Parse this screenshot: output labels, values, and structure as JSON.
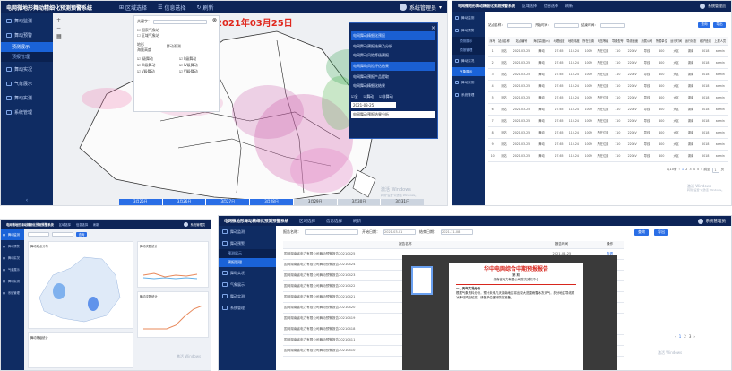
{
  "app_title": "电网微地形舞动精细化预测预警系统",
  "nav": [
    "区域选择",
    "信息选择",
    "刷新"
  ],
  "user": "系统管理员",
  "sidebar1": [
    "舞动监测",
    "舞动预警",
    "预测展示",
    "预报管理",
    "舞动实况",
    "气象展示",
    "舞动实测",
    "系统管理"
  ],
  "sidebar2": [
    "舞动监测",
    "舞动预警",
    "预测展示",
    "预报管理",
    "舞动实况",
    "气象展示",
    "舞动实测",
    "系统管理"
  ],
  "map": {
    "date": "2021年03月25日",
    "legend_search": "关键字：",
    "legend_checks": [
      "国家气象站",
      "区域气象站",
      "地形",
      "海拔高度"
    ],
    "legend_right": "舞动观测",
    "legend_levels": [
      "I级舞动",
      "II级舞动",
      "III级舞动",
      "IV级舞动",
      "V级舞动",
      "VI级舞动"
    ],
    "panel_items": [
      "电网舞动精细化预报",
      "电网舞动预报结果及分析",
      "电网舞动风险等级预报",
      "电网舞动风险评估结果",
      "电网舞动预报产品提取",
      "电网舞动精细化结果"
    ],
    "panel_checks": [
      "全",
      "舞动",
      "非舞动"
    ],
    "panel_date": "2021-03-25",
    "panel_select": "电网舞动预报结果分析",
    "timeline": [
      "3月25日",
      "3月26日",
      "3月27日",
      "3月28日",
      "3月29日",
      "3月30日",
      "3月31日"
    ],
    "activate": [
      "激活 Windows",
      "转到\"设置\"以激活 Windows。"
    ]
  },
  "table": {
    "filters": [
      "站点名称：",
      "开始时间：",
      "结束时间：",
      "站点名称：",
      "开始日期："
    ],
    "search": "查询",
    "export": "导出",
    "headers": [
      "序号",
      "站点名称",
      "站点编号",
      "海拔高度(m)",
      "地理经度",
      "地理纬度",
      "所在位置",
      "电压等级",
      "导线型号",
      "导线截面",
      "所属公司",
      "所属单位",
      "运行时间",
      "运行状态",
      "维护班组",
      "上报人员"
    ],
    "rows": [
      [
        "1",
        "测站",
        "2021-03-25",
        "舞动",
        "27.65",
        "110.24",
        "1009",
        "所在位置",
        "110",
        "220kV",
        "导线",
        "400",
        "大区",
        "湖南",
        "2018",
        "admin"
      ],
      [
        "2",
        "测站",
        "2021-03-25",
        "舞动",
        "27.65",
        "110.24",
        "1009",
        "所在位置",
        "110",
        "220kV",
        "导线",
        "400",
        "大区",
        "湖南",
        "2018",
        "admin"
      ],
      [
        "3",
        "测站",
        "2021-03-25",
        "舞动",
        "27.65",
        "110.24",
        "1009",
        "所在位置",
        "110",
        "220kV",
        "导线",
        "400",
        "大区",
        "湖南",
        "2018",
        "admin"
      ],
      [
        "4",
        "测站",
        "2021-03-25",
        "舞动",
        "27.65",
        "110.24",
        "1009",
        "所在位置",
        "110",
        "220kV",
        "导线",
        "400",
        "大区",
        "湖南",
        "2018",
        "admin"
      ],
      [
        "5",
        "测站",
        "2021-03-25",
        "舞动",
        "27.65",
        "110.24",
        "1009",
        "所在位置",
        "110",
        "220kV",
        "导线",
        "400",
        "大区",
        "湖南",
        "2018",
        "admin"
      ],
      [
        "6",
        "测站",
        "2021-03-25",
        "舞动",
        "27.65",
        "110.24",
        "1009",
        "所在位置",
        "110",
        "220kV",
        "导线",
        "400",
        "大区",
        "湖南",
        "2018",
        "admin"
      ],
      [
        "7",
        "测站",
        "2021-03-25",
        "舞动",
        "27.65",
        "110.24",
        "1009",
        "所在位置",
        "110",
        "220kV",
        "导线",
        "400",
        "大区",
        "湖南",
        "2018",
        "admin"
      ],
      [
        "8",
        "测站",
        "2021-03-25",
        "舞动",
        "27.65",
        "110.24",
        "1009",
        "所在位置",
        "110",
        "220kV",
        "导线",
        "400",
        "大区",
        "湖南",
        "2018",
        "admin"
      ],
      [
        "9",
        "测站",
        "2021-03-25",
        "舞动",
        "27.65",
        "110.24",
        "1009",
        "所在位置",
        "110",
        "220kV",
        "导线",
        "400",
        "大区",
        "湖南",
        "2018",
        "admin"
      ],
      [
        "10",
        "测站",
        "2021-03-25",
        "舞动",
        "27.65",
        "110.24",
        "1009",
        "所在位置",
        "110",
        "220kV",
        "导线",
        "400",
        "大区",
        "湖南",
        "2018",
        "admin"
      ]
    ],
    "pager": [
      "共10条",
      "1",
      "2",
      "3",
      "4",
      "5",
      "跳至",
      "1",
      "页"
    ],
    "activate": [
      "激活 Windows",
      "转到\"设置\"以激活 Windows。"
    ]
  },
  "dash": {
    "topnav": [
      "区域选择",
      "信息选择",
      "刷新"
    ],
    "sidebar": [
      "舞动监测",
      "舞动预警",
      "舞动实况",
      "气象展示",
      "舞动实测",
      "系统管理"
    ],
    "filter": "查询",
    "cards": [
      "舞动站点分布",
      "舞动次数统计",
      "舞动次数统计",
      "舞动等级统计"
    ],
    "activate": "激活 Windows"
  },
  "report": {
    "sidebar": [
      "舞动监测",
      "舞动预警",
      "预测展示",
      "预报管理",
      "舞动实况",
      "气象展示",
      "舞动实测",
      "系统管理"
    ],
    "filters": [
      "报告名称：",
      "开始日期：",
      "2021-03-01",
      "结束日期：",
      "2021-11-08"
    ],
    "search": "查询",
    "export": "导出",
    "headers": [
      "报告名称",
      "报告时间",
      "操作"
    ],
    "rows": [
      [
        "国网湖南省电力有限公司舞动预警报告20210425",
        "2021-04-25",
        "查看"
      ],
      [
        "国网湖南省电力有限公司舞动预警报告20210424",
        "2021-04-24",
        "查看"
      ],
      [
        "国网湖南省电力有限公司舞动预警报告20210423",
        "2021-04-23",
        "查看"
      ],
      [
        "国网湖南省电力有限公司舞动预警报告20210422",
        "2021-04-22",
        "查看"
      ],
      [
        "国网湖南省电力有限公司舞动预警报告20210421",
        "2021-04-21",
        "查看"
      ],
      [
        "国网湖南省电力有限公司舞动预警报告20210420",
        "2021-04-20",
        "查看"
      ],
      [
        "国网湖南省电力有限公司舞动预警报告20210419",
        "2021-04-19",
        "查看"
      ],
      [
        "国网湖南省电力有限公司舞动预警报告20210418",
        "2021-04-18",
        "查看"
      ],
      [
        "国网湖南省电力有限公司舞动预警报告20210411",
        "2021-04-11",
        "查看"
      ],
      [
        "国网湖南省电力有限公司舞动预警报告20210410",
        "2021-04-10",
        "查看"
      ]
    ],
    "doc": {
      "title": "华中电网综合中期预报报告",
      "sub": "第 期",
      "org": "湖南省电力有限公司防灾减灾中心",
      "sect": "一、天气实况分析",
      "para": "根据气象资料分析，预计未来几天湖南地区将出现大范围雨雪冰冻天气，部分地区导线覆冰舞动风险较高，请各单位做好防范准备。"
    },
    "pager": [
      "1",
      "2",
      "3"
    ],
    "activate": "激活 Windows"
  }
}
